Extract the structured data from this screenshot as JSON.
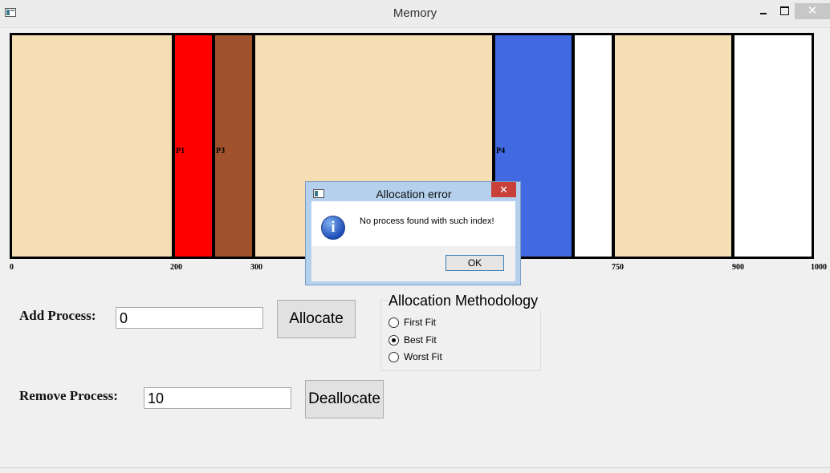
{
  "window": {
    "title": "Memory",
    "minimize_icon": "minimize-icon",
    "maximize_icon": "maximize-icon",
    "close_glyph": "✕"
  },
  "memory_map": {
    "total": 1000,
    "blocks": [
      {
        "start": 0,
        "end": 200,
        "label": "",
        "color": "#f5deb3"
      },
      {
        "start": 200,
        "end": 250,
        "label": "P1",
        "color": "#ff0000"
      },
      {
        "start": 250,
        "end": 300,
        "label": "P3",
        "color": "#a0522d"
      },
      {
        "start": 300,
        "end": 600,
        "label": "",
        "color": "#f5deb3"
      },
      {
        "start": 600,
        "end": 700,
        "label": "P4",
        "color": "#4169e1"
      },
      {
        "start": 700,
        "end": 750,
        "label": "",
        "color": "#ffffff"
      },
      {
        "start": 750,
        "end": 900,
        "label": "",
        "color": "#f5deb3"
      },
      {
        "start": 900,
        "end": 1000,
        "label": "",
        "color": "#ffffff"
      }
    ],
    "ticks": [
      "0",
      "200",
      "300",
      "750",
      "900",
      "1000"
    ]
  },
  "add_process": {
    "label": "Add Process:",
    "value": "0",
    "button": "Allocate"
  },
  "remove_process": {
    "label": "Remove Process:",
    "value": "10",
    "button": "Deallocate"
  },
  "methodology": {
    "title": "Allocation Methodology",
    "options": [
      {
        "label": "First Fit",
        "checked": false
      },
      {
        "label": "Best Fit",
        "checked": true
      },
      {
        "label": "Worst Fit",
        "checked": false
      }
    ]
  },
  "dialog": {
    "title": "Allocation error",
    "message": "No process found with such index!",
    "ok_label": "OK",
    "icon": "info-icon",
    "close_glyph": "✕"
  }
}
